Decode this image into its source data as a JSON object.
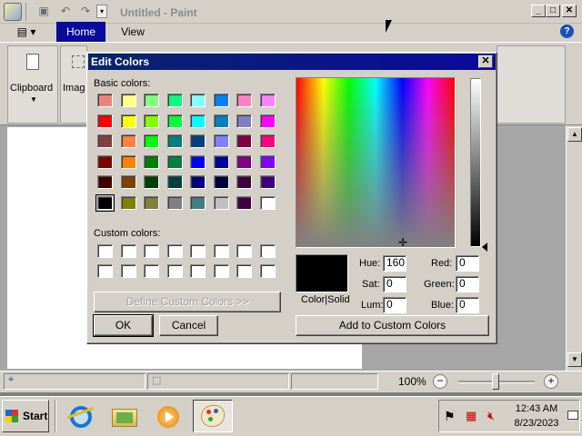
{
  "paint": {
    "title": "Untitled - Paint",
    "qat": {
      "save_icon": "save-icon",
      "undo_icon": "undo-icon",
      "redo_icon": "redo-icon",
      "dropdown": "▾"
    },
    "window_controls": {
      "minimize": "_",
      "maximize": "□",
      "close": "✕"
    },
    "tabs": [
      {
        "label": "Home",
        "active": true
      },
      {
        "label": "View",
        "active": false
      }
    ],
    "ribbon_groups": [
      {
        "label": "Clipboard"
      },
      {
        "label": "Imag"
      }
    ],
    "status": {
      "zoom": "100%",
      "zoom_out": "−",
      "zoom_in": "+"
    },
    "zoom_level": 1.0
  },
  "dialog": {
    "title": "Edit Colors",
    "close": "✕",
    "basic_colors_label": "Basic colors:",
    "custom_colors_label": "Custom colors:",
    "define_custom_label": "Define Custom Colors >>",
    "ok_label": "OK",
    "cancel_label": "Cancel",
    "color_solid_label": "Color|Solid",
    "add_custom_label": "Add to Custom Colors",
    "hue_label": "Hue:",
    "hue": "160",
    "sat_label": "Sat:",
    "sat": "0",
    "lum_label": "Lum:",
    "lum": "0",
    "red_label": "Red:",
    "red": "0",
    "green_label": "Green:",
    "green": "0",
    "blue_label": "Blue:",
    "blue": "0",
    "basic_colors": [
      [
        "#f08080",
        "#ffff80",
        "#80ff80",
        "#00ff80",
        "#80ffff",
        "#0080ff",
        "#ff80c0",
        "#ff80ff"
      ],
      [
        "#ff0000",
        "#ffff00",
        "#80ff00",
        "#00ff40",
        "#00ffff",
        "#0080c0",
        "#8080c0",
        "#ff00ff"
      ],
      [
        "#804040",
        "#ff8040",
        "#00ff00",
        "#008080",
        "#004080",
        "#8080ff",
        "#800040",
        "#ff0080"
      ],
      [
        "#800000",
        "#ff8000",
        "#008000",
        "#008040",
        "#0000ff",
        "#0000a0",
        "#800080",
        "#8000ff"
      ],
      [
        "#400000",
        "#804000",
        "#004000",
        "#004040",
        "#000080",
        "#000040",
        "#400040",
        "#400080"
      ],
      [
        "#000000",
        "#808000",
        "#808040",
        "#808080",
        "#408080",
        "#c0c0c0",
        "#400040",
        "#ffffff"
      ]
    ],
    "selected_basic": [
      5,
      0
    ],
    "custom_colors": [
      [
        "#ffffff",
        "#ffffff",
        "#ffffff",
        "#ffffff",
        "#ffffff",
        "#ffffff",
        "#ffffff",
        "#ffffff"
      ],
      [
        "#ffffff",
        "#ffffff",
        "#ffffff",
        "#ffffff",
        "#ffffff",
        "#ffffff",
        "#ffffff",
        "#ffffff"
      ]
    ]
  },
  "taskbar": {
    "start_label": "Start",
    "apps": [
      {
        "icon": "internet-explorer-icon"
      },
      {
        "icon": "explorer-folder-icon"
      },
      {
        "icon": "media-player-icon"
      },
      {
        "icon": "paint-icon",
        "active": true
      }
    ],
    "tray": [
      "flag-icon",
      "network-icon",
      "volume-muted-icon"
    ],
    "time": "12:43 AM",
    "date": "8/23/2023"
  }
}
